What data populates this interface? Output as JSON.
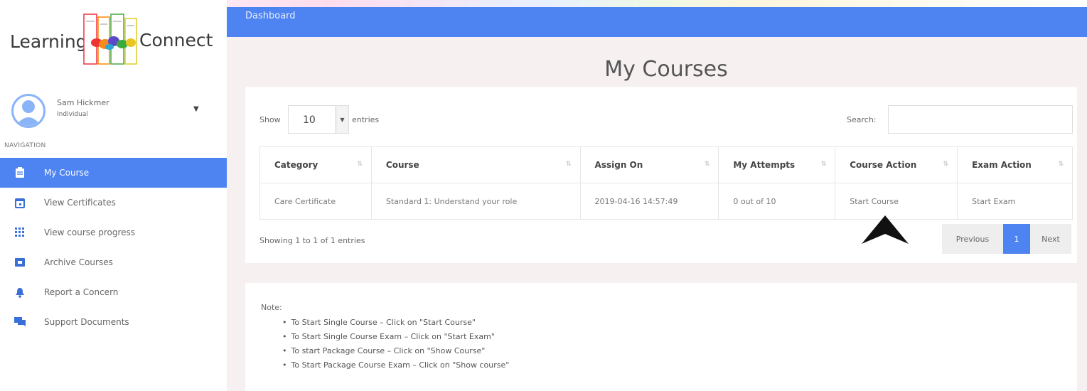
{
  "brand": {
    "left": "Learning",
    "right": "Connect"
  },
  "user": {
    "name": "Sam Hickmer",
    "role": "Individual"
  },
  "nav": {
    "heading": "NAVIGATION",
    "items": [
      {
        "label": "My Course",
        "icon": "clipboard-icon",
        "active": true
      },
      {
        "label": "View Certificates",
        "icon": "calendar-icon",
        "active": false
      },
      {
        "label": "View course progress",
        "icon": "grid-icon",
        "active": false
      },
      {
        "label": "Archive Courses",
        "icon": "archive-icon",
        "active": false
      },
      {
        "label": "Report a Concern",
        "icon": "bell-icon",
        "active": false
      },
      {
        "label": "Support Documents",
        "icon": "chat-icon",
        "active": false
      }
    ]
  },
  "header": {
    "title": "Dashboard"
  },
  "page": {
    "title": "My Courses"
  },
  "table_controls": {
    "show_label": "Show",
    "page_size": "10",
    "entries_label": "entries",
    "search_label": "Search:",
    "search_value": ""
  },
  "table": {
    "columns": [
      "Category",
      "Course",
      "Assign On",
      "My Attempts",
      "Course Action",
      "Exam Action"
    ],
    "rows": [
      [
        "Care Certificate",
        "Standard 1: Understand your role",
        "2019-04-16 14:57:49",
        "0 out of 10",
        "Start Course",
        "Start Exam"
      ]
    ]
  },
  "footer": {
    "showing": "Showing 1 to 1 of 1 entries",
    "prev": "Previous",
    "page": "1",
    "next": "Next"
  },
  "note": {
    "title": "Note:",
    "items": [
      "To Start Single Course – Click on \"Start Course\"",
      "To Start Single Course Exam – Click on \"Start Exam\"",
      "To start Package Course – Click on \"Show Course\"",
      "To Start Package Course Exam – Click on \"Show course\""
    ]
  },
  "colors": {
    "primary": "#4e84f2",
    "success": "#5cb85c",
    "content_bg": "#f6f0f1"
  }
}
